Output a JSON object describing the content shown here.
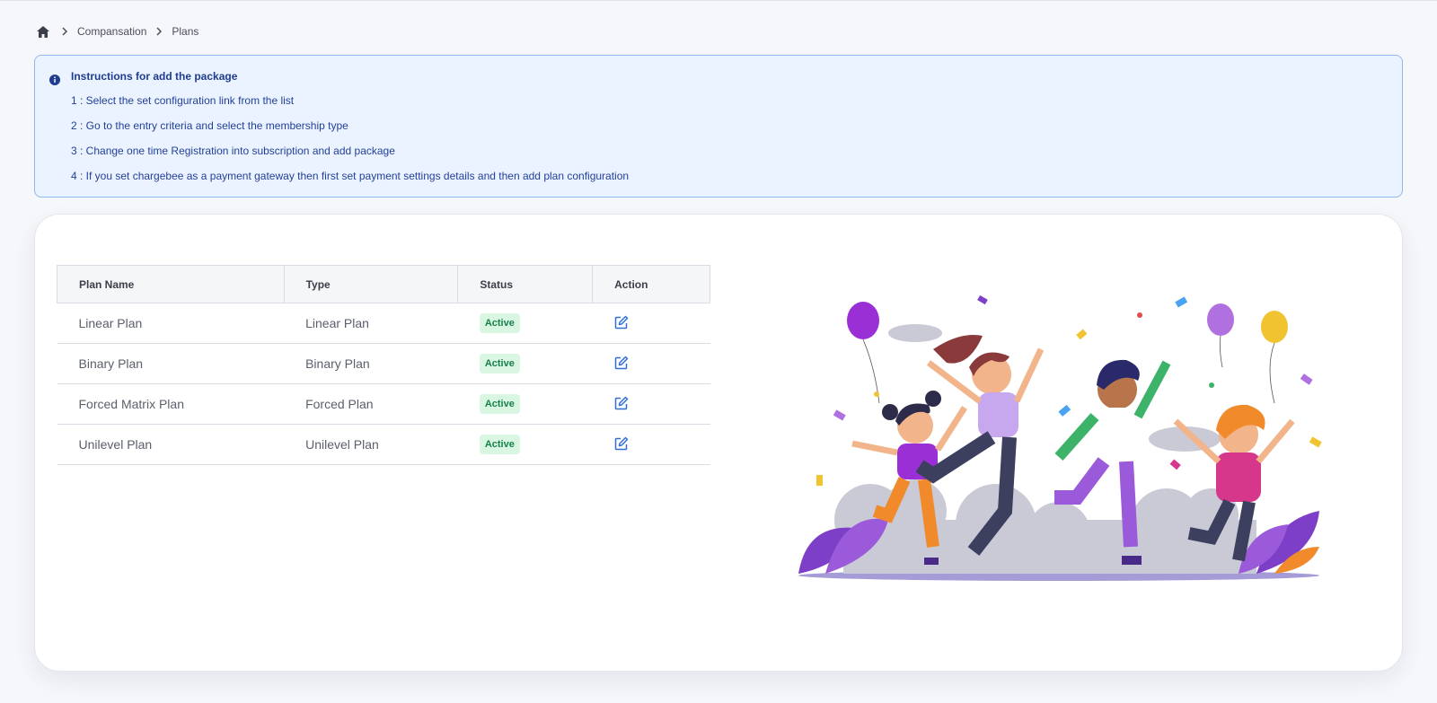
{
  "breadcrumb": {
    "home_icon": "home-icon",
    "items": [
      "Compansation",
      "Plans"
    ]
  },
  "instructions": {
    "title": "Instructions for add the package",
    "icon": "info-icon",
    "steps": [
      "1 : Select the set configuration link from the list",
      "2 : Go to the entry criteria and select the membership type",
      "3 : Change one time Registration into subscription and add package",
      "4 : If you set chargebee as a payment gateway then first set payment settings details and then add plan configuration"
    ]
  },
  "table": {
    "headers": [
      "Plan Name",
      "Type",
      "Status",
      "Action"
    ],
    "rows": [
      {
        "name": "Linear Plan",
        "type": "Linear Plan",
        "status": "Active"
      },
      {
        "name": "Binary Plan",
        "type": "Binary Plan",
        "status": "Active"
      },
      {
        "name": "Forced Matrix Plan",
        "type": "Forced Plan",
        "status": "Active"
      },
      {
        "name": "Unilevel Plan",
        "type": "Unilevel Plan",
        "status": "Active"
      }
    ],
    "action_icon": "edit-icon"
  },
  "colors": {
    "accent": "#2f6fd6",
    "info_bg": "#eaf3ff",
    "info_border": "#8db8f0",
    "badge_bg": "#d9f6e3",
    "badge_text": "#17804a"
  }
}
